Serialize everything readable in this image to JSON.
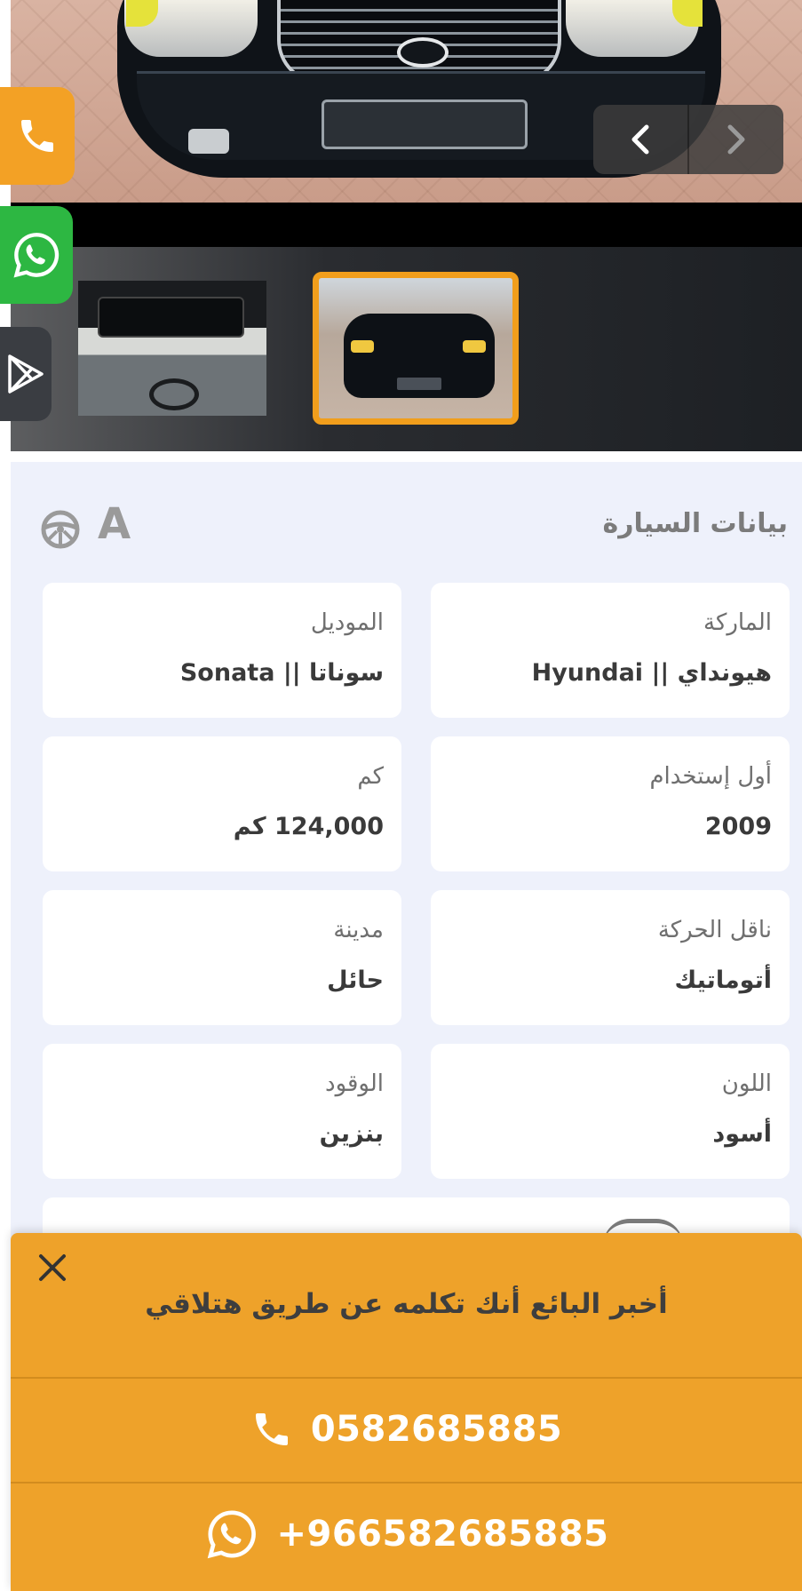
{
  "gallery": {
    "prev_icon": "chevron-left-icon",
    "next_icon": "chevron-right-icon",
    "thumbnails": [
      "car-interior-thumbnail",
      "car-front-thumbnail"
    ],
    "active_thumbnail": 1,
    "accent_color": "#f19e1c"
  },
  "side_contacts": {
    "phone_icon": "phone-icon",
    "whatsapp_icon": "whatsapp-icon",
    "play_icon": "google-play-icon",
    "phone_color": "#f3a125",
    "whatsapp_color": "#2db742"
  },
  "details": {
    "title": "بيانات السيارة",
    "badge_letter": "A",
    "badge_icon": "steering-wheel-icon",
    "fields": [
      {
        "label": "الماركة",
        "value": "هيونداي || Hyundai"
      },
      {
        "label": "الموديل",
        "value": "سوناتا || Sonata"
      },
      {
        "label": "أول إستخدام",
        "value": "2009"
      },
      {
        "label": "كم",
        "value": "124,000 كم"
      },
      {
        "label": "ناقل الحركة",
        "value": "أتوماتيك"
      },
      {
        "label": "مدينة",
        "value": "حائل"
      },
      {
        "label": "اللون",
        "value": "أسود"
      },
      {
        "label": "الوقود",
        "value": "بنزين"
      }
    ]
  },
  "contact_sheet": {
    "message": "أخبر البائع أنك تكلمه عن طريق هتلاقي",
    "phone": "0582685885",
    "whatsapp": "+966582685885",
    "close_icon": "close-icon",
    "background_color": "#eea22a"
  }
}
